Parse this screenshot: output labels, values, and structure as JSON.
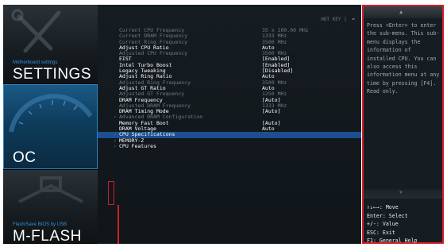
{
  "sidebar": {
    "settings": {
      "subtitle": "Motherboard settings",
      "title": "SETTINGS"
    },
    "oc": {
      "title": "OC"
    },
    "mflash": {
      "subtitle": "Flash/Save BIOS by USB",
      "title": "M-FLASH"
    }
  },
  "header": {
    "hotkey_label": "HOT KEY",
    "divider": "|",
    "back_icon": "back-arrow-icon"
  },
  "rows": [
    {
      "label": "Current CPU Frequency",
      "value": "35 x 100.00 MHz",
      "style": "dim"
    },
    {
      "label": "Current DRAM Frequency",
      "value": "1333 MHz",
      "style": "dim"
    },
    {
      "label": "Current Ring Frequency",
      "value": "3500 MHz",
      "style": "dim"
    },
    {
      "label": "Adjust CPU Ratio",
      "value": "Auto",
      "style": "norm"
    },
    {
      "label": "Adjusted CPU Frequency",
      "value": "3500 MHz",
      "style": "dim"
    },
    {
      "label": "EIST",
      "value": "[Enabled]",
      "style": "norm"
    },
    {
      "label": "Intel Turbo Boost",
      "value": "[Enabled]",
      "style": "norm"
    },
    {
      "label": "Legacy Tweaking",
      "value": "[Disabled]",
      "style": "norm"
    },
    {
      "label": "Adjust Ring Ratio",
      "value": "Auto",
      "style": "norm"
    },
    {
      "label": "Adjusted Ring Frequency",
      "value": "3500 MHz",
      "style": "dim"
    },
    {
      "label": "Adjust GT Ratio",
      "value": "Auto",
      "style": "norm"
    },
    {
      "label": "Adjusted GT Frequency",
      "value": "1250 MHz",
      "style": "dim"
    },
    {
      "label": "DRAM Frequency",
      "value": "[Auto]",
      "style": "norm"
    },
    {
      "label": "Adjusted DRAM Frequency",
      "value": "1333 MHz",
      "style": "dim"
    },
    {
      "label": "DRAM Timing Mode",
      "value": "[Auto]",
      "style": "norm"
    },
    {
      "label": "Advanced DRAM Configuration",
      "value": "",
      "style": "dim",
      "submenu": true
    },
    {
      "label": "Memory Fast Boot",
      "value": "[Auto]",
      "style": "norm"
    },
    {
      "label": "DRAM Voltage",
      "value": "Auto",
      "style": "norm"
    },
    {
      "label": "CPU Specifications",
      "value": "",
      "style": "sel",
      "submenu": true
    },
    {
      "label": "MEMORY-Z",
      "value": "",
      "style": "norm",
      "submenu": true
    },
    {
      "label": "CPU Features",
      "value": "",
      "style": "norm",
      "submenu": true
    }
  ],
  "help": {
    "text": "Press <Enter> to enter the sub-menu. This sub-menu displays the information of installed CPU. You can also access this information menu at any time by pressing [F4]. Read only.",
    "keys": [
      "↑↓←→: Move",
      "Enter: Select",
      "+/-: Value",
      "ESC: Exit",
      "F1: General Help"
    ]
  },
  "colors": {
    "accent": "#2f8fe0",
    "highlight": "#d21d2a",
    "selected_row": "#1b4f8f"
  }
}
